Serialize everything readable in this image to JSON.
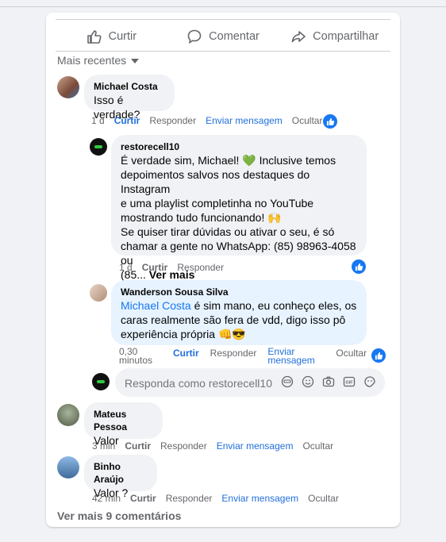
{
  "actions": {
    "like": "Curtir",
    "comment": "Comentar",
    "share": "Compartilhar"
  },
  "sort_label": "Mais recentes",
  "comments": [
    {
      "author": "Michael Costa",
      "text": "Isso é verdade?",
      "time": "1 d",
      "like": "Curtir",
      "reply": "Responder",
      "message": "Enviar mensagem",
      "hide": "Ocultar"
    },
    {
      "author": "restorecell10",
      "lines": [
        "É verdade sim, Michael! 💚 Inclusive temos",
        "depoimentos salvos nos destaques do Instagram",
        "e uma playlist completinha no YouTube",
        "mostrando tudo funcionando! 🙌",
        "Se quiser tirar dúvidas ou ativar o seu, é só",
        "chamar a gente no WhatsApp: (85) 98963-4058 ou",
        "(85..."
      ],
      "see_more": "Ver mais",
      "time": "1 d",
      "like": "Curtir",
      "reply": "Responder"
    },
    {
      "author": "Wanderson Sousa Silva",
      "mention": "Michael Costa",
      "text_line1": " é sim mano, eu conheço eles, os",
      "text_line2": "caras realmente são fera de vdd, digo isso pô",
      "text_line3": "experiência própria 👊😎",
      "time": "0,30 minutos",
      "like": "Curtir",
      "reply": "Responder",
      "message": "Enviar mensagem",
      "hide": "Ocultar"
    },
    {
      "author": "Mateus Pessoa",
      "text": "Valor",
      "time": "3 min",
      "like": "Curtir",
      "reply": "Responder",
      "message": "Enviar mensagem",
      "hide": "Ocultar"
    },
    {
      "author": "Binho Araújo",
      "text": "Valor ?",
      "time": "42 min",
      "like": "Curtir",
      "reply": "Responder",
      "message": "Enviar mensagem",
      "hide": "Ocultar"
    }
  ],
  "reply_box": {
    "placeholder": "Responda como restorecell10"
  },
  "view_more": "Ver mais 9 comentários",
  "colors": {
    "accent": "#1877f2",
    "muted": "#65676b",
    "bubble": "#f0f2f5"
  }
}
